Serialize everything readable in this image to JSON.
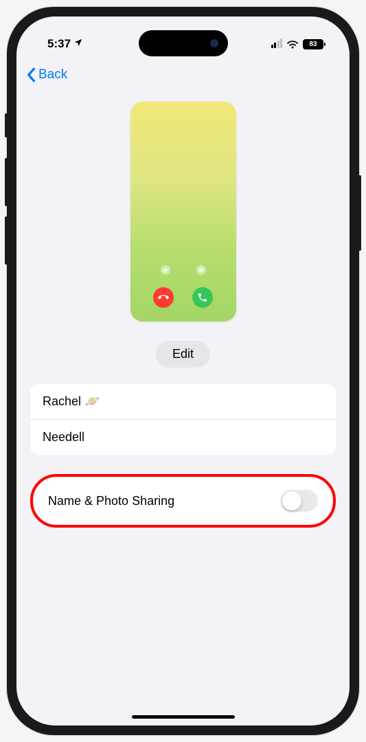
{
  "statusBar": {
    "time": "5:37",
    "batteryPercent": "83"
  },
  "nav": {
    "backLabel": "Back"
  },
  "editButton": {
    "label": "Edit"
  },
  "nameFields": {
    "firstName": "Rachel 🪐",
    "lastName": "Needell"
  },
  "sharing": {
    "label": "Name & Photo Sharing",
    "enabled": false
  }
}
